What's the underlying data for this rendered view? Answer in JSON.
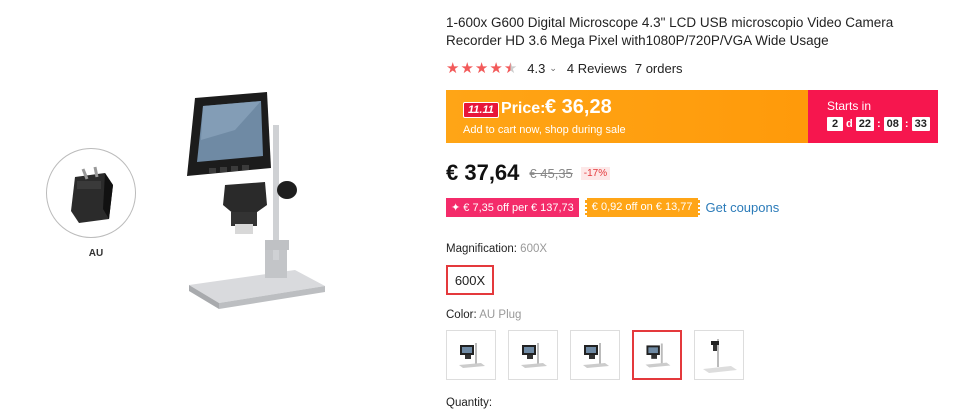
{
  "gallery": {
    "plug_label": "AU"
  },
  "product": {
    "title": "1-600x G600 Digital Microscope 4.3\" LCD USB microscopio Video Camera Recorder HD 3.6 Mega Pixel with1080P/720P/VGA Wide Usage",
    "rating": "4.3",
    "rating_stars": 4.3,
    "reviews": "4 Reviews",
    "orders": "7 orders"
  },
  "promo": {
    "badge": "11.11",
    "price_label": "Price:",
    "price": "€ 36,28",
    "subtext": "Add to cart now, shop during sale",
    "starts_in": "Starts in",
    "countdown": {
      "days": "2",
      "days_unit": "d",
      "hours": "22",
      "minutes": "08",
      "seconds": "33"
    },
    "colors": {
      "orange": "#ffa516",
      "pink": "#f6164e"
    }
  },
  "price": {
    "current": "€ 37,64",
    "original": "€ 45,35",
    "discount": "-17%"
  },
  "coupons": {
    "coupon1": "✦ € 7,35 off per € 137,73",
    "coupon2": "€ 0,92 off on € 13,77",
    "get_coupons": "Get coupons"
  },
  "options": {
    "magnification_label": "Magnification:",
    "magnification_value": "600X",
    "magnification_chip": "600X",
    "color_label": "Color:",
    "color_value": "AU Plug",
    "color_count": 5,
    "selected_color_index": 3,
    "quantity_label": "Quantity:"
  }
}
